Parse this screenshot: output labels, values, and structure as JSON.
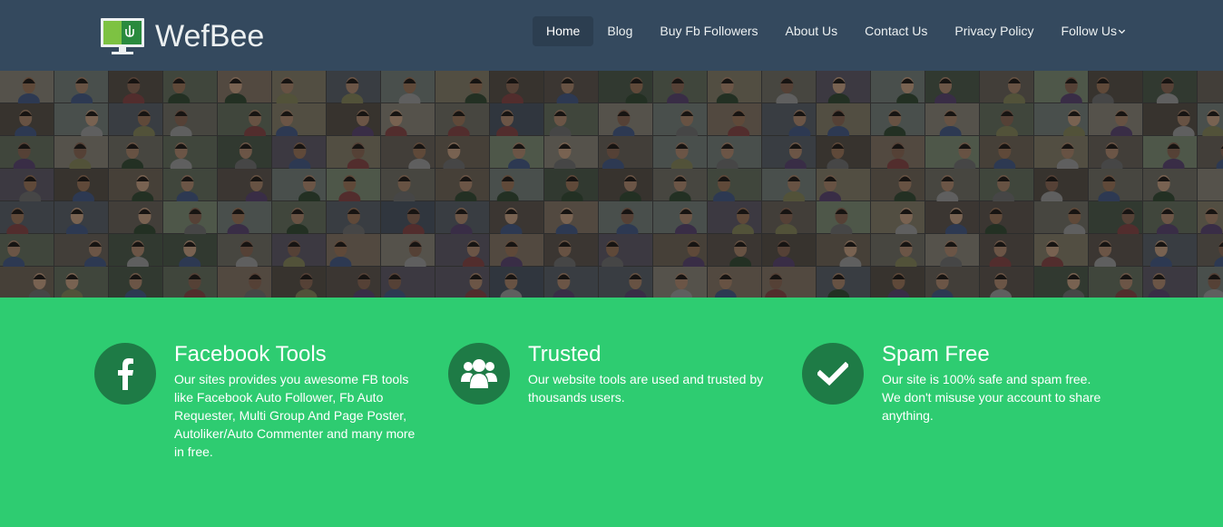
{
  "brand": {
    "name": "WefBee",
    "logo_icon": "monitor-plug-icon"
  },
  "nav": {
    "items": [
      {
        "label": "Home",
        "active": true
      },
      {
        "label": "Blog"
      },
      {
        "label": "Buy Fb Followers"
      },
      {
        "label": "About Us"
      },
      {
        "label": "Contact Us"
      },
      {
        "label": "Privacy Policy"
      },
      {
        "label": "Follow Us",
        "dropdown": true
      }
    ]
  },
  "hero": {
    "content": "profile-photo-mosaic"
  },
  "features": [
    {
      "icon": "facebook-icon",
      "title": "Facebook Tools",
      "description": "Our sites provides you awesome FB tools like Facebook Auto Follower, Fb Auto Requester, Multi Group And Page Poster, Autoliker/Auto Commenter and many more in free."
    },
    {
      "icon": "users-icon",
      "title": "Trusted",
      "description": "Our website tools are used and trusted by thousands users."
    },
    {
      "icon": "check-icon",
      "title": "Spam Free",
      "description": "Our site is 100% safe and spam free. We don't misuse your account to share anything."
    }
  ],
  "colors": {
    "navbar": "#34495e",
    "nav_active": "#2c3e50",
    "accent_green": "#2ecc71",
    "icon_circle": "#1e7b46"
  }
}
